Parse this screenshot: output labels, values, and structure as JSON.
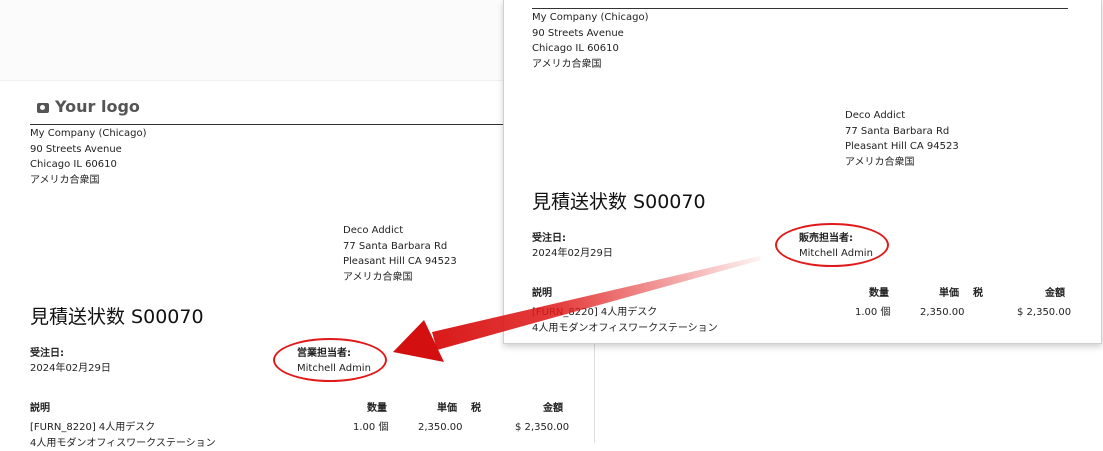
{
  "company": {
    "name": "My Company (Chicago)",
    "street": "90 Streets Avenue",
    "city": "Chicago IL 60610",
    "country": "アメリカ合衆国"
  },
  "customer": {
    "name": "Deco Addict",
    "street": "77 Santa Barbara Rd",
    "city": "Pleasant Hill CA 94523",
    "country": "アメリカ合衆国"
  },
  "left_doc": {
    "logo_text": "Your logo",
    "title": "見積送状数 S00070",
    "order_date_label": "受注日:",
    "order_date": "2024年02月29日",
    "salesperson_label": "営業担当者:",
    "salesperson": "Mitchell Admin",
    "columns": {
      "description": "説明",
      "quantity": "数量",
      "unit_price": "単価",
      "tax": "税",
      "amount": "金額"
    },
    "line": {
      "description_1": "[FURN_8220] 4人用デスク",
      "description_2": "4人用モダンオフィスワークステーション",
      "quantity": "1.00 個",
      "unit_price": "2,350.00",
      "amount": "$ 2,350.00"
    }
  },
  "right_doc": {
    "title": "見積送状数 S00070",
    "order_date_label": "受注日:",
    "order_date": "2024年02月29日",
    "salesperson_label": "販売担当者:",
    "salesperson": "Mitchell Admin",
    "columns": {
      "description": "説明",
      "quantity": "数量",
      "unit_price": "単価",
      "tax": "税",
      "amount": "金額"
    },
    "line": {
      "description_1": "[FURN_8220] 4人用デスク",
      "description_2": "4人用モダンオフィスワークステーション",
      "quantity": "1.00 個",
      "unit_price": "2,350.00",
      "amount": "$ 2,350.00"
    }
  },
  "colors": {
    "highlight": "#e01a1a",
    "link_code": "#b07a3a"
  }
}
